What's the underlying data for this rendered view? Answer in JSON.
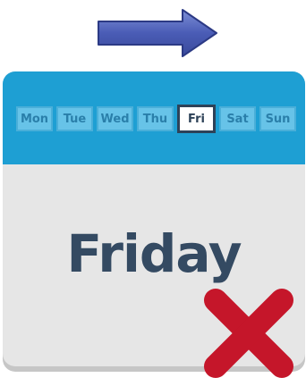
{
  "arrow": {
    "icon": "right-arrow-icon",
    "color": "#3b4da3"
  },
  "calendar": {
    "header_color": "#1e9fd3",
    "days": [
      {
        "label": "Mon",
        "active": false
      },
      {
        "label": "Tue",
        "active": false
      },
      {
        "label": "Wed",
        "active": false
      },
      {
        "label": "Thu",
        "active": false
      },
      {
        "label": "Fri",
        "active": true
      },
      {
        "label": "Sat",
        "active": false
      },
      {
        "label": "Sun",
        "active": false
      }
    ],
    "day_name": "Friday"
  },
  "cross": {
    "icon": "red-x-icon",
    "color": "#c5162a"
  }
}
